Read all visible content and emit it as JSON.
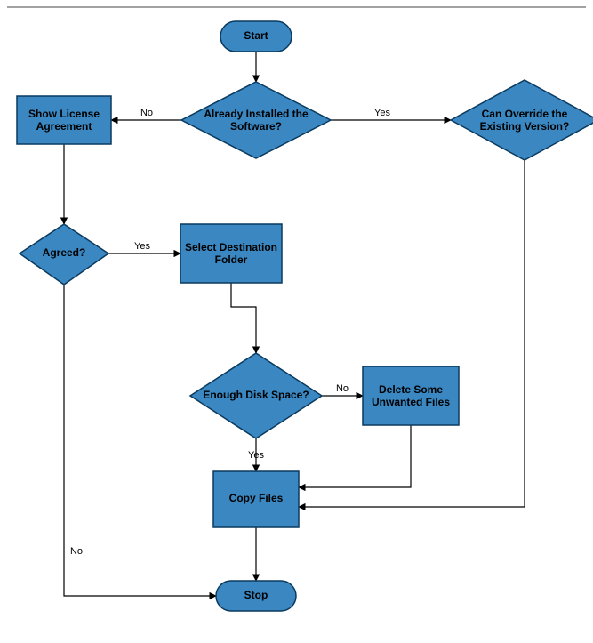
{
  "flowchart": {
    "nodes": {
      "start": {
        "label": "Start"
      },
      "already_installed": {
        "label1": "Already Installed the",
        "label2": "Software?"
      },
      "show_license": {
        "label1": "Show License",
        "label2": "Agreement"
      },
      "can_override": {
        "label1": "Can Override the",
        "label2": "Existing Version?"
      },
      "agreed": {
        "label": "Agreed?"
      },
      "select_dest": {
        "label1": "Select Destination",
        "label2": "Folder"
      },
      "enough_disk": {
        "label": "Enough Disk Space?"
      },
      "delete_unwanted": {
        "label1": "Delete Some",
        "label2": "Unwanted Files"
      },
      "copy_files": {
        "label": "Copy Files"
      },
      "stop": {
        "label": "Stop"
      }
    },
    "edges": {
      "already_no": "No",
      "already_yes": "Yes",
      "agreed_yes": "Yes",
      "agreed_no": "No",
      "disk_no": "No",
      "disk_yes": "Yes"
    }
  },
  "chart_data": {
    "type": "flowchart",
    "nodes": [
      {
        "id": "start",
        "kind": "terminator",
        "text": "Start"
      },
      {
        "id": "already_installed",
        "kind": "decision",
        "text": "Already Installed the Software?"
      },
      {
        "id": "show_license",
        "kind": "process",
        "text": "Show License Agreement"
      },
      {
        "id": "can_override",
        "kind": "decision",
        "text": "Can Override the Existing Version?"
      },
      {
        "id": "agreed",
        "kind": "decision",
        "text": "Agreed?"
      },
      {
        "id": "select_dest",
        "kind": "process",
        "text": "Select Destination Folder"
      },
      {
        "id": "enough_disk",
        "kind": "decision",
        "text": "Enough Disk Space?"
      },
      {
        "id": "delete_unwanted",
        "kind": "process",
        "text": "Delete Some Unwanted Files"
      },
      {
        "id": "copy_files",
        "kind": "process",
        "text": "Copy Files"
      },
      {
        "id": "stop",
        "kind": "terminator",
        "text": "Stop"
      }
    ],
    "edges": [
      {
        "from": "start",
        "to": "already_installed"
      },
      {
        "from": "already_installed",
        "to": "show_license",
        "label": "No"
      },
      {
        "from": "already_installed",
        "to": "can_override",
        "label": "Yes"
      },
      {
        "from": "show_license",
        "to": "agreed"
      },
      {
        "from": "agreed",
        "to": "select_dest",
        "label": "Yes"
      },
      {
        "from": "agreed",
        "to": "stop",
        "label": "No"
      },
      {
        "from": "select_dest",
        "to": "enough_disk"
      },
      {
        "from": "enough_disk",
        "to": "copy_files",
        "label": "Yes"
      },
      {
        "from": "enough_disk",
        "to": "delete_unwanted",
        "label": "No"
      },
      {
        "from": "delete_unwanted",
        "to": "copy_files"
      },
      {
        "from": "can_override",
        "to": "copy_files"
      },
      {
        "from": "copy_files",
        "to": "stop"
      }
    ]
  }
}
